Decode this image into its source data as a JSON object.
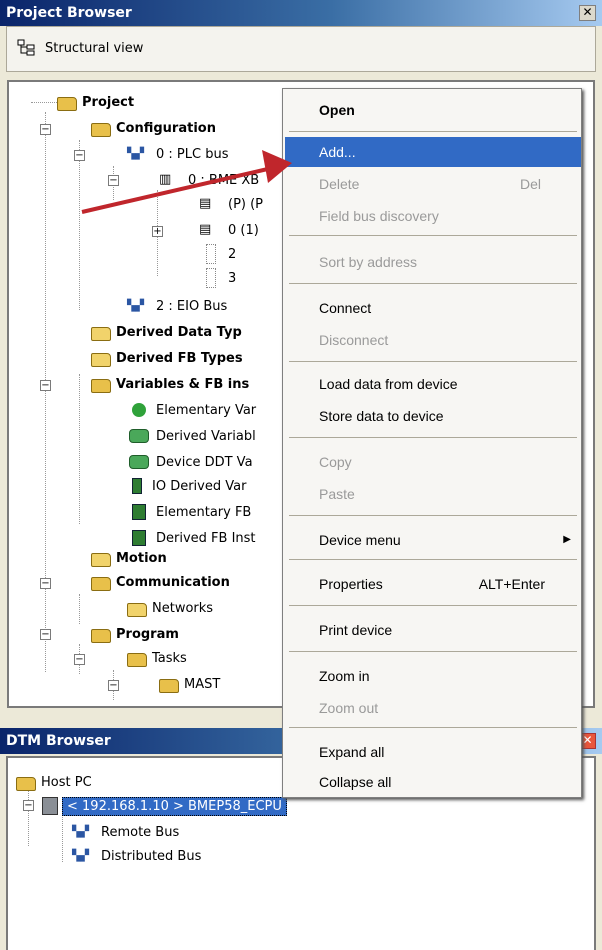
{
  "project_browser": {
    "title": "Project Browser",
    "close_label": "✕",
    "view_label": "Structural view"
  },
  "tree": [
    {
      "label": "Project",
      "bold": true,
      "icon": "folder-open-icon"
    },
    {
      "label": "Configuration",
      "bold": true,
      "icon": "folder-open-icon"
    },
    {
      "label": "0 : PLC bus",
      "icon": "bus-icon"
    },
    {
      "label": "0 : BME XB",
      "icon": "rack-icon"
    },
    {
      "label": "(P) (P",
      "icon": "module-icon"
    },
    {
      "label": "0 (1)",
      "icon": "module-icon"
    },
    {
      "label": "2",
      "icon": "empty-slot-icon"
    },
    {
      "label": "3",
      "icon": "empty-slot-icon"
    },
    {
      "label": "2 : EIO Bus",
      "icon": "bus-icon"
    },
    {
      "label": "Derived Data Typ",
      "bold": true,
      "icon": "folder-icon"
    },
    {
      "label": "Derived FB Types",
      "bold": true,
      "icon": "folder-icon"
    },
    {
      "label": "Variables & FB ins",
      "bold": true,
      "icon": "folder-open-icon"
    },
    {
      "label": "Elementary Var",
      "icon": "green-dot-icon"
    },
    {
      "label": "Derived Variabl",
      "icon": "ddt-icon"
    },
    {
      "label": "Device DDT Va",
      "icon": "ddt-icon"
    },
    {
      "label": "IO Derived Var",
      "icon": "io-icon"
    },
    {
      "label": "Elementary FB",
      "icon": "fb-icon"
    },
    {
      "label": "Derived FB Inst",
      "icon": "fb-icon"
    },
    {
      "label": "Motion",
      "bold": true,
      "icon": "folder-icon"
    },
    {
      "label": "Communication",
      "bold": true,
      "icon": "folder-open-icon"
    },
    {
      "label": "Networks",
      "icon": "folder-icon"
    },
    {
      "label": "Program",
      "bold": true,
      "icon": "folder-open-icon"
    },
    {
      "label": "Tasks",
      "icon": "folder-open-icon"
    },
    {
      "label": "MAST",
      "icon": "folder-open-icon"
    }
  ],
  "context_menu": {
    "items": [
      {
        "label": "Open",
        "bold": true
      },
      {
        "label": "Add...",
        "selected": true
      },
      {
        "label": "Delete",
        "shortcut": "Del",
        "disabled": true
      },
      {
        "label": "Field bus discovery",
        "disabled": true
      },
      {
        "label": "Sort  by address",
        "disabled": true
      },
      {
        "label": "Connect"
      },
      {
        "label": "Disconnect",
        "disabled": true
      },
      {
        "label": "Load data from device"
      },
      {
        "label": "Store data to device"
      },
      {
        "label": "Copy",
        "disabled": true
      },
      {
        "label": "Paste",
        "disabled": true
      },
      {
        "label": "Device menu",
        "submenu": true
      },
      {
        "label": "Properties",
        "shortcut": "ALT+Enter"
      },
      {
        "label": "Print device"
      },
      {
        "label": "Zoom in"
      },
      {
        "label": "Zoom out",
        "disabled": true
      },
      {
        "label": "Expand all"
      },
      {
        "label": "Collapse all"
      }
    ]
  },
  "dtm_browser": {
    "title": "DTM Browser",
    "close_label": "✕",
    "host": "Host PC",
    "device": "< 192.168.1.10 > BMEP58_ECPU",
    "children": [
      "Remote Bus",
      "Distributed Bus"
    ]
  },
  "colors": {
    "selection": "#316ac5",
    "titlebar": "#0a246a",
    "arrow": "#c0262c"
  }
}
